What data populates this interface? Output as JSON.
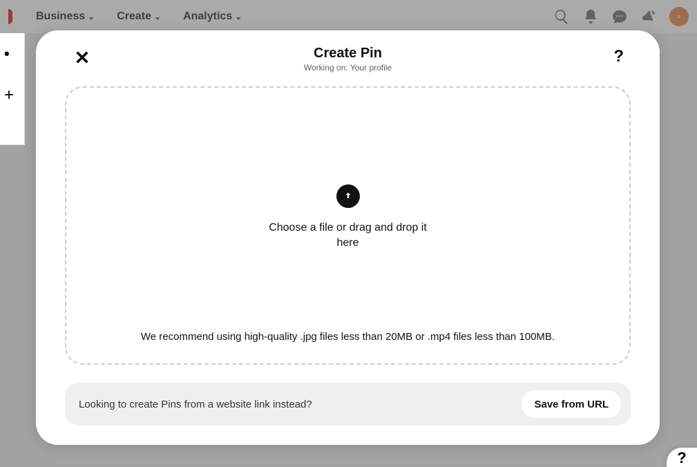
{
  "nav": {
    "items": [
      "Business",
      "Create",
      "Analytics"
    ],
    "icons": [
      "search-icon",
      "bell-icon",
      "chat-icon",
      "megaphone-icon"
    ]
  },
  "modal": {
    "title": "Create Pin",
    "subtitle": "Working on: Your profile",
    "help": "?",
    "drop_main": "Choose a file or drag and drop it here",
    "drop_recommend": "We recommend using high-quality .jpg files less than 20MB or .mp4 files less than 100MB."
  },
  "url_bar": {
    "text": "Looking to create Pins from a website link instead?",
    "button": "Save from URL"
  },
  "floating_help": "?"
}
